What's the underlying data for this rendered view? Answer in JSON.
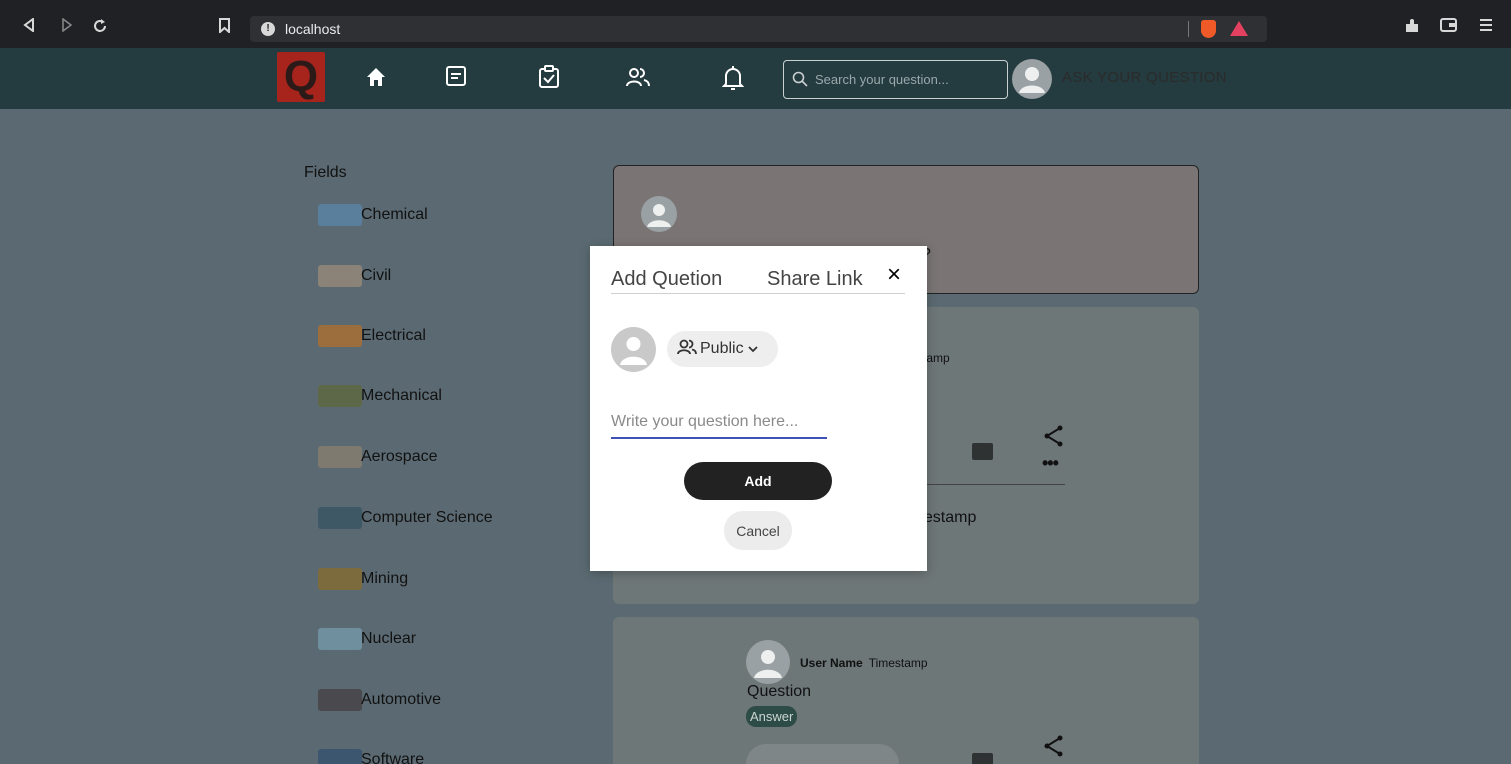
{
  "browser": {
    "url": "localhost",
    "back_icon": "back-icon",
    "forward_icon": "forward-icon",
    "reload_icon": "reload-icon",
    "bookmark_icon": "bookmark-icon"
  },
  "nav": {
    "logo_text": "Q",
    "search_placeholder": "Search your question...",
    "ask_label": "ASK YOUR QUESTION",
    "icons": [
      "home-icon",
      "news-icon",
      "task-check-icon",
      "people-icon",
      "bell-icon"
    ]
  },
  "sidebar": {
    "title": "Fields",
    "items": [
      {
        "label": "Chemical",
        "color": "#5a7f9c"
      },
      {
        "label": "Civil",
        "color": "#8b8378"
      },
      {
        "label": "Electrical",
        "color": "#9c6e3e"
      },
      {
        "label": "Mechanical",
        "color": "#5c6848"
      },
      {
        "label": "Aerospace",
        "color": "#7f7a70"
      },
      {
        "label": "Computer Science",
        "color": "#3f5866"
      },
      {
        "label": "Mining",
        "color": "#7c6b3c"
      },
      {
        "label": "Nuclear",
        "color": "#6f8f9e"
      },
      {
        "label": "Automotive",
        "color": "#4a4a4e"
      },
      {
        "label": "Software",
        "color": "#3d5670"
      }
    ]
  },
  "feed": {
    "question_box_partial": "?",
    "post1": {
      "meta_partial": "tamp",
      "timestamp_partial": "nestamp"
    },
    "post2": {
      "user_name": "User Name",
      "timestamp": "Timestamp",
      "question": "Question",
      "answer_label": "Answer"
    }
  },
  "modal": {
    "tab_add": "Add Quetion",
    "tab_share": "Share Link",
    "close": "×",
    "visibility": "Public",
    "input_placeholder": "Write your question here...",
    "add_label": "Add",
    "cancel_label": "Cancel"
  },
  "colors": {
    "accent_underline": "#3f51b5",
    "nav_bg": "#243b3f",
    "logo_red": "#a7241d",
    "answer_bg": "#2d4c47"
  }
}
